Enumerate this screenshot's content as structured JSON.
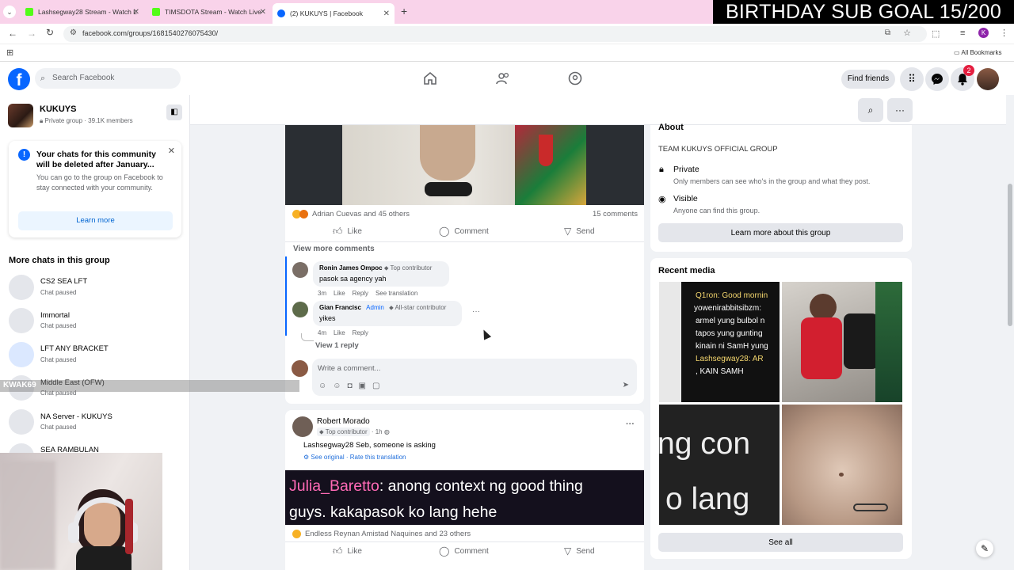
{
  "browser": {
    "tabs": [
      {
        "label": "Lashsegway28 Stream - Watch L"
      },
      {
        "label": "TIMSDOTA Stream - Watch Live"
      },
      {
        "label": "(2) KUKUYS | Facebook"
      }
    ],
    "url": "facebook.com/groups/1681540276075430/",
    "all_bookmarks": "All Bookmarks"
  },
  "overlay": {
    "banner": "BIRTHDAY SUB GOAL 15/200",
    "chat_username": "KWAK69"
  },
  "header": {
    "search_placeholder": "Search Facebook",
    "find_friends": "Find friends",
    "notification_count": "2",
    "profile_initial": "K"
  },
  "left": {
    "group_name": "KUKUYS",
    "group_meta": "Private group · 39.1K members",
    "notice_title": "Your chats for this community will be deleted after January...",
    "notice_body": "You can go to the group on Facebook to stay connected with your community.",
    "learn_more": "Learn more",
    "more_chats_title": "More chats in this group",
    "chats": [
      {
        "name": "CS2 SEA LFT",
        "status": "Chat paused"
      },
      {
        "name": "Immortal",
        "status": "Chat paused"
      },
      {
        "name": "LFT ANY BRACKET",
        "status": "Chat paused"
      },
      {
        "name": "Middle East (OFW)",
        "status": "Chat paused"
      },
      {
        "name": "NA Server - KUKUYS",
        "status": "Chat paused"
      },
      {
        "name": "SEA RAMBULAN",
        "status": ""
      }
    ]
  },
  "post1": {
    "reactions": "Adrian Cuevas and 45 others",
    "comments_count": "15 comments",
    "like": "Like",
    "comment": "Comment",
    "send": "Send",
    "view_more": "View more comments",
    "comments": [
      {
        "author": "Ronin James Ompoc",
        "badge": "Top contributor",
        "text": "pasok sa agency yah",
        "time": "3m",
        "like": "Like",
        "reply": "Reply",
        "translate": "See translation"
      },
      {
        "author": "Gian Francisc",
        "admin": "Admin",
        "badge": "All-star contributor",
        "text": "yikes",
        "time": "4m",
        "like": "Like",
        "reply": "Reply"
      }
    ],
    "view_reply": "View 1 reply",
    "write_placeholder": "Write a comment..."
  },
  "post2": {
    "author": "Robert Morado",
    "badge": "Top contributor",
    "time": "1h",
    "text": "Lashsegway28 Seb, someone is asking",
    "see_original": "See original",
    "rate": "Rate this translation",
    "image_user": "Julia_Baretto",
    "image_line1": ": anong context ng good thing",
    "image_line2": "guys. kakapasok ko lang hehe",
    "reactions": "Endless Reynan Amistad Naquines and 23 others",
    "like": "Like",
    "comment": "Comment",
    "send": "Send"
  },
  "about": {
    "title": "About",
    "description": "TEAM KUKUYS OFFICIAL GROUP",
    "private_title": "Private",
    "private_desc": "Only members can see who's in the group and what they post.",
    "visible_title": "Visible",
    "visible_desc": "Anyone can find this group.",
    "learn_more": "Learn more about this group"
  },
  "media": {
    "title": "Recent media",
    "thumb1_lines": [
      "Q1ron: Good mornin",
      "yowenirabbitsibzm:",
      "armel yung bulbol n",
      "tapos yung gunting",
      "kinain ni SamH yung",
      "Lashsegway28: AR",
      ", KAIN SAMH"
    ],
    "thumb3_line1": "ng con",
    "thumb3_line2": "o lang",
    "see_all": "See all"
  },
  "colors": {
    "fb_blue": "#0866ff",
    "link_blue": "#216fdb",
    "banner_bg": "#000000",
    "tab_bar": "#f9d3ea"
  }
}
